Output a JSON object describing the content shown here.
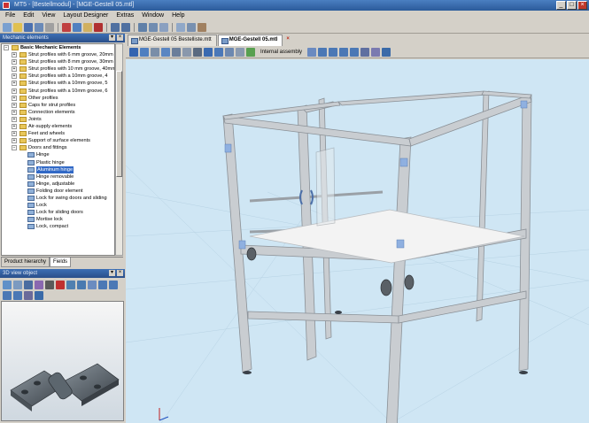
{
  "window": {
    "title": "MT5 - [Bestellmodul] - [MGE-Gestell 05.mtl]",
    "controls": [
      "_",
      "□",
      "×"
    ]
  },
  "menu": [
    "File",
    "Edit",
    "View",
    "Layout Designer",
    "Extras",
    "Window",
    "Help"
  ],
  "catalog": {
    "title": "Mechanic elements",
    "items": [
      {
        "label": "Basic Mechanic Elements",
        "level": 0,
        "icon": "folder-icon",
        "bold": true,
        "exp": "−"
      },
      {
        "label": "Strut profiles with 6 mm groove, 20mm",
        "level": 1,
        "icon": "folder-icon",
        "exp": "+"
      },
      {
        "label": "Strut profiles with 8 mm groove, 30mm",
        "level": 1,
        "icon": "folder-icon",
        "exp": "+"
      },
      {
        "label": "Strut profiles with 10 mm groove, 40mm",
        "level": 1,
        "icon": "folder-icon",
        "exp": "+"
      },
      {
        "label": "Strut profiles with a 10mm groove, 4",
        "level": 1,
        "icon": "folder-icon",
        "exp": "+"
      },
      {
        "label": "Strut profiles with a 10mm groove, 5",
        "level": 1,
        "icon": "folder-icon",
        "exp": "+"
      },
      {
        "label": "Strut profiles with a 10mm groove, 6",
        "level": 1,
        "icon": "folder-icon",
        "exp": "+"
      },
      {
        "label": "Other profiles",
        "level": 1,
        "icon": "folder-icon",
        "exp": "+"
      },
      {
        "label": "Caps for strut profiles",
        "level": 1,
        "icon": "folder-icon",
        "exp": "+"
      },
      {
        "label": "Connection elements",
        "level": 1,
        "icon": "folder-icon",
        "exp": "+"
      },
      {
        "label": "Joints",
        "level": 1,
        "icon": "folder-icon",
        "exp": "+"
      },
      {
        "label": "Air-supply elements",
        "level": 1,
        "icon": "folder-icon",
        "exp": "+"
      },
      {
        "label": "Feet and wheels",
        "level": 1,
        "icon": "folder-icon",
        "exp": "+"
      },
      {
        "label": "Support of surface elements",
        "level": 1,
        "icon": "folder-icon",
        "exp": "+"
      },
      {
        "label": "Doors and fittings",
        "level": 1,
        "icon": "folder-icon",
        "exp": "−"
      },
      {
        "label": "Hinge",
        "level": 2,
        "icon": "part-icon"
      },
      {
        "label": "Plastic hinge",
        "level": 2,
        "icon": "part-icon"
      },
      {
        "label": "Aluminum hinge",
        "level": 2,
        "icon": "part-icon",
        "selected": true
      },
      {
        "label": "Hinge removable",
        "level": 2,
        "icon": "part-icon"
      },
      {
        "label": "Hinge, adjustable",
        "level": 2,
        "icon": "part-icon"
      },
      {
        "label": "Folding door element",
        "level": 2,
        "icon": "part-icon"
      },
      {
        "label": "Lock for swing doors and sliding",
        "level": 2,
        "icon": "part-icon"
      },
      {
        "label": "Lock",
        "level": 2,
        "icon": "part-icon"
      },
      {
        "label": "Lock for sliding doors",
        "level": 2,
        "icon": "part-icon"
      },
      {
        "label": "Mortise lock",
        "level": 2,
        "icon": "part-icon"
      },
      {
        "label": "Lock, compact",
        "level": 2,
        "icon": "part-icon"
      }
    ]
  },
  "bottom_tabs": [
    "Product hierarchy",
    "Fields"
  ],
  "preview": {
    "title": "3D view object"
  },
  "doc_tabs": [
    "MGE-Gestell 05 Bestelliste.mtt",
    "MGE-Gestell 05.mtl"
  ],
  "doc_tab_close": "×",
  "view_toolbar": {
    "internal_assembly": "Internal assembly"
  },
  "colors": {
    "titlebar": "#2b5a9a",
    "viewport_bg": "#cfe6f4",
    "profile": "#c8ccd0",
    "selection": "#3169c6"
  }
}
